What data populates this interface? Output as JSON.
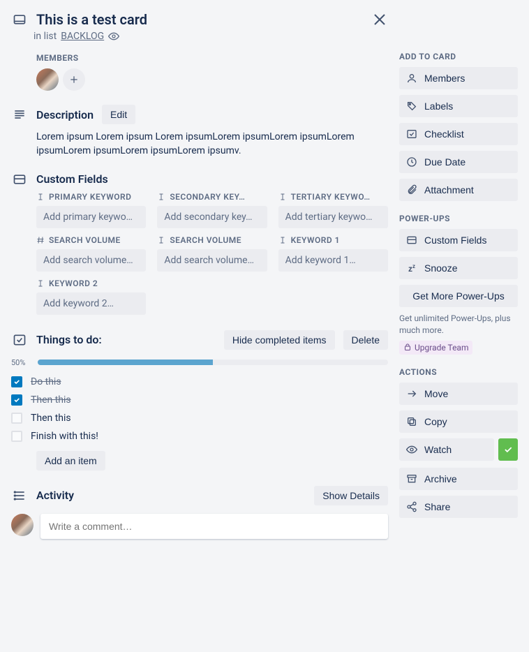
{
  "header": {
    "title": "This is a test card",
    "in_list_prefix": "in list ",
    "list_name": "BACKLOG"
  },
  "members": {
    "heading": "MEMBERS"
  },
  "description": {
    "heading": "Description",
    "edit_label": "Edit",
    "text": "Lorem ipsum Lorem ipsum Lorem ipsumLorem ipsumLorem ipsumLorem ipsumLorem ipsumLorem ipsumLorem ipsumv."
  },
  "custom_fields": {
    "heading": "Custom Fields",
    "items": [
      {
        "icon": "T",
        "label": "PRIMARY KEYWORD",
        "placeholder": "Add primary keywo…"
      },
      {
        "icon": "T",
        "label": "SECONDARY KEY…",
        "placeholder": "Add secondary key…"
      },
      {
        "icon": "T",
        "label": "TERTIARY KEYWO…",
        "placeholder": "Add tertiary keywo…"
      },
      {
        "icon": "#",
        "label": "SEARCH VOLUME",
        "placeholder": "Add search volume…"
      },
      {
        "icon": "T",
        "label": "SEARCH VOLUME",
        "placeholder": "Add search volume…"
      },
      {
        "icon": "T",
        "label": "KEYWORD 1",
        "placeholder": "Add keyword 1…"
      },
      {
        "icon": "T",
        "label": "KEYWORD 2",
        "placeholder": "Add keyword 2…"
      }
    ]
  },
  "checklist": {
    "title": "Things to do:",
    "hide_label": "Hide completed items",
    "delete_label": "Delete",
    "progress_pct": "50%",
    "progress_value": 50,
    "items": [
      {
        "text": "Do this",
        "done": true
      },
      {
        "text": "Then this",
        "done": true
      },
      {
        "text": "Then this",
        "done": false
      },
      {
        "text": "Finish with this!",
        "done": false
      }
    ],
    "add_item_label": "Add an item"
  },
  "activity": {
    "heading": "Activity",
    "show_details_label": "Show Details",
    "comment_placeholder": "Write a comment…"
  },
  "sidebar": {
    "add_to_card": {
      "heading": "ADD TO CARD",
      "items": [
        {
          "label": "Members"
        },
        {
          "label": "Labels"
        },
        {
          "label": "Checklist"
        },
        {
          "label": "Due Date"
        },
        {
          "label": "Attachment"
        }
      ]
    },
    "powerups": {
      "heading": "POWER-UPS",
      "items": [
        {
          "label": "Custom Fields"
        },
        {
          "label": "Snooze"
        }
      ],
      "more_label": "Get More Power-Ups",
      "helper": "Get unlimited Power-Ups, plus much more.",
      "upgrade_label": "Upgrade Team"
    },
    "actions": {
      "heading": "ACTIONS",
      "move": "Move",
      "copy": "Copy",
      "watch": "Watch",
      "archive": "Archive",
      "share": "Share"
    }
  }
}
